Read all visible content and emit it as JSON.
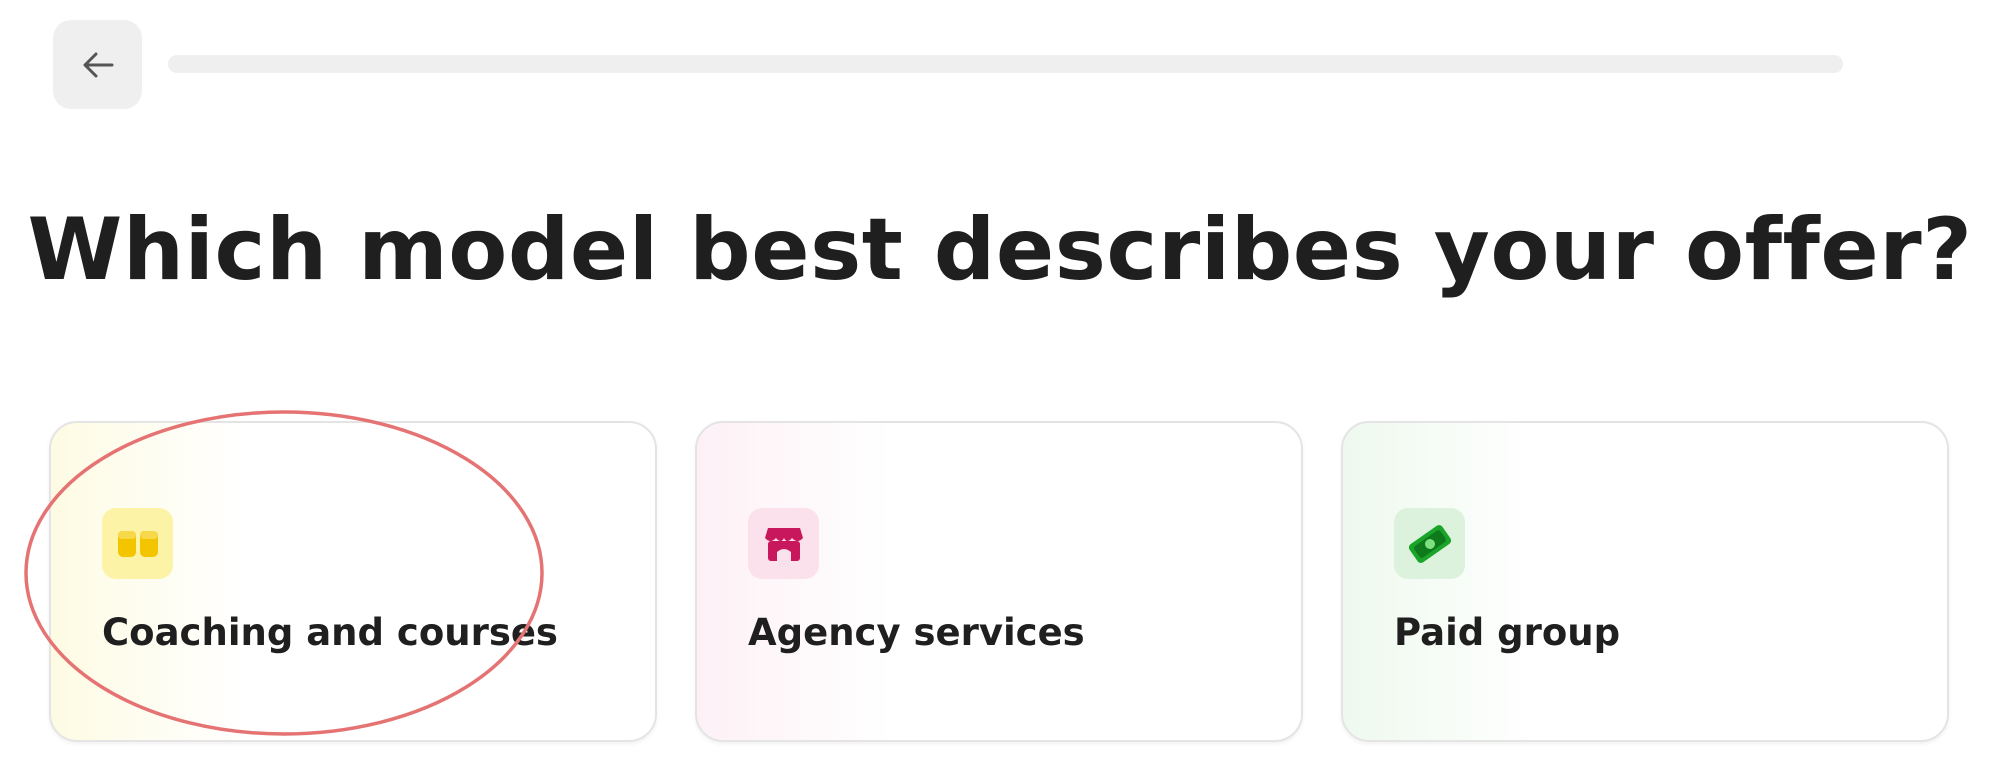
{
  "header": {
    "back_icon": "arrow-left-icon",
    "progress_fraction": 0.0
  },
  "title": "Which model best describes your offer?",
  "options": [
    {
      "label": "Coaching and courses",
      "icon": "book-icon",
      "accent": "#fdf3a6",
      "icon_color": "#f2c500"
    },
    {
      "label": "Agency services",
      "icon": "storefront-icon",
      "accent": "#fbe1ec",
      "icon_color": "#c8175d"
    },
    {
      "label": "Paid group",
      "icon": "money-bill-icon",
      "accent": "#ddf2dd",
      "icon_color": "#1aa52a"
    }
  ],
  "annotation": {
    "type": "ellipse",
    "color": "#e57373",
    "target": "Coaching and courses"
  }
}
